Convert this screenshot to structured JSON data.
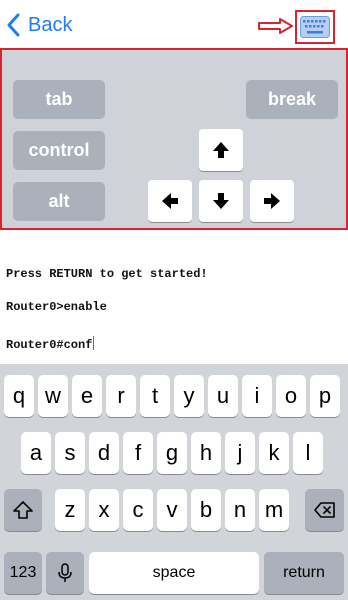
{
  "nav": {
    "back_label": "Back"
  },
  "panel": {
    "tab": "tab",
    "break": "break",
    "control": "control",
    "alt": "alt"
  },
  "terminal": {
    "line1": "Press RETURN to get started!",
    "line2": "Router0>enable",
    "line3": "Router0#conf"
  },
  "keyboard": {
    "row1": [
      "q",
      "w",
      "e",
      "r",
      "t",
      "y",
      "u",
      "i",
      "o",
      "p"
    ],
    "row2": [
      "a",
      "s",
      "d",
      "f",
      "g",
      "h",
      "j",
      "k",
      "l"
    ],
    "row3": [
      "z",
      "x",
      "c",
      "v",
      "b",
      "n",
      "m"
    ],
    "numbers_label": "123",
    "space_label": "space",
    "return_label": "return"
  },
  "icons": {
    "back": "chevron-left-icon",
    "keyboard_toggle": "keyboard-icon",
    "annotation": "red-arrow-icon",
    "shift": "shift-icon",
    "delete": "backspace-icon",
    "mic": "microphone-icon",
    "arrows": [
      "arrow-up-icon",
      "arrow-left-icon",
      "arrow-down-icon",
      "arrow-right-icon"
    ]
  },
  "colors": {
    "accent": "#1f7cf6",
    "highlight": "#d9232d",
    "panel_bg": "#cfd3d9",
    "special_key": "#aab1bb",
    "keyboard_bg": "#d1d4d9"
  }
}
